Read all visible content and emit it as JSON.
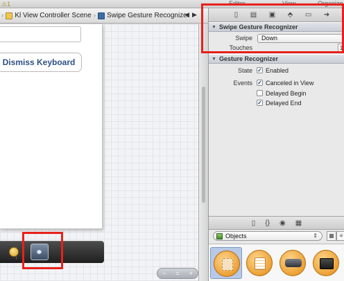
{
  "toolbar": {
    "icon_badge": "1",
    "labels": [
      "Editor",
      "View",
      "Organize"
    ]
  },
  "jumpbar": {
    "crumbs": [
      "Kl View Controller Scene",
      "Swipe Gesture Recognizer"
    ],
    "nav_prev": "◀",
    "nav_next": "▶"
  },
  "canvas": {
    "dismiss_label": "Dismiss Keyboard",
    "zoom_out": "−",
    "zoom_fit": "=",
    "zoom_in": "+"
  },
  "inspector": {
    "tab_icons": [
      "file-icon",
      "quick-help-icon",
      "identity-icon",
      "attributes-icon",
      "size-icon",
      "connections-icon"
    ],
    "swipe_section": {
      "title": "Swipe Gesture Recognizer",
      "swipe_label": "Swipe",
      "swipe_value": "Down",
      "touches_label": "Touches",
      "touches_value": "1"
    },
    "gesture_section": {
      "title": "Gesture Recognizer",
      "state_label": "State",
      "enabled_label": "Enabled",
      "enabled": true,
      "events_label": "Events",
      "events": [
        {
          "label": "Canceled in View",
          "checked": true
        },
        {
          "label": "Delayed Begin",
          "checked": false
        },
        {
          "label": "Delayed End",
          "checked": true
        }
      ]
    },
    "library": {
      "tab_icons": [
        "file-template-icon",
        "code-snippet-icon",
        "object-icon",
        "media-icon"
      ],
      "filter_value": "Objects"
    }
  },
  "colors": {
    "highlight": "#e8201b",
    "button_text": "#2e4f86",
    "object_orange": "#e38b12"
  }
}
